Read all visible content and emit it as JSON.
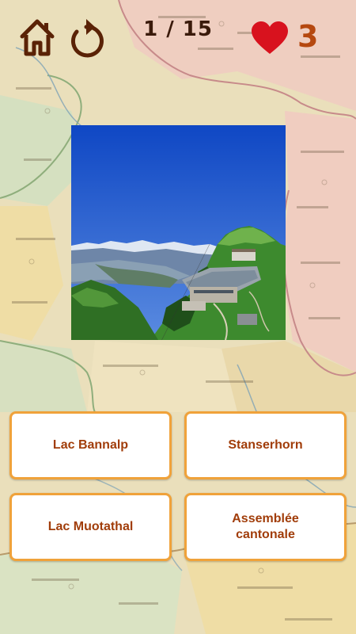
{
  "header": {
    "home_icon": "home-icon",
    "replay_icon": "replay-icon",
    "progress": "1 / 15",
    "heart_icon": "heart-icon",
    "lives": "3"
  },
  "quiz": {
    "answers": [
      {
        "label": "Lac Bannalp"
      },
      {
        "label": "Stanserhorn"
      },
      {
        "label": "Lac Muotathal"
      },
      {
        "label": "Assemblée cantonale"
      }
    ]
  },
  "colors": {
    "accent": "#b5480f",
    "answer_border": "#f0a23a",
    "answer_text": "#a13d0a",
    "heart": "#d8121e",
    "progress_text": "#3a1a0a"
  }
}
